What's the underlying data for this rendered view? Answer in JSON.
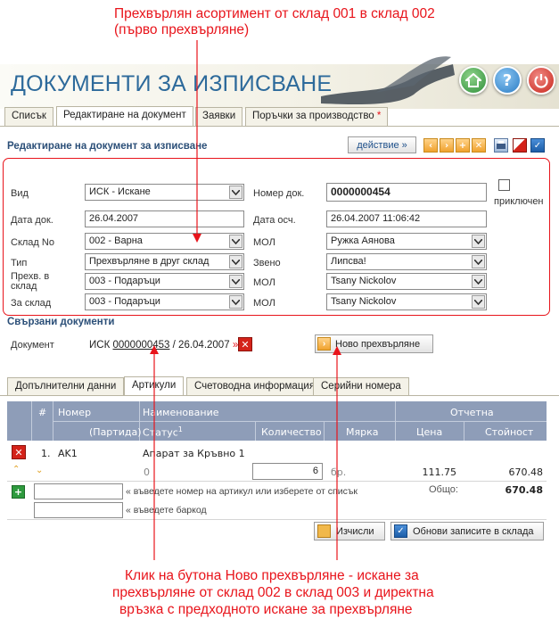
{
  "annotations": {
    "top_line1": "Прехвърлян асортимент от склад 001 в склад 002",
    "top_line2": "(първо прехвърляне)",
    "bottom_line1": "Клик на бутона Ново прехвърляне - искане за",
    "bottom_line2": "прехвърляне от склад 002 в склад 003 и директна",
    "bottom_line3": "връзка с предходното искане за прехвърляне"
  },
  "header": {
    "title": "ДОКУМЕНТИ ЗА ИЗПИСВАНЕ"
  },
  "tabs": [
    {
      "label": "Списък"
    },
    {
      "label": "Редактиране на документ"
    },
    {
      "label": "Заявки"
    },
    {
      "label": "Поръчки за производство",
      "marker": "*"
    }
  ],
  "edit": {
    "title": "Редактиране на документ за изписване",
    "action_label": "действие »"
  },
  "form": {
    "vid_label": "Вид",
    "vid_value": "ИСК - Искане",
    "nomer_label": "Номер док.",
    "nomer_value": "0000000454",
    "prikl_label": "приключен",
    "data_label": "Дата док.",
    "data_value": "26.04.2007",
    "data_osch_label": "Дата осч.",
    "data_osch_value": "26.04.2007 11:06:42",
    "sklad_label": "Склад No",
    "sklad_value": "002 - Варна",
    "mol1_label": "МОЛ",
    "mol1_value": "Ружка Аянова",
    "tip_label": "Тип",
    "tip_value": "Прехвърляне в друг склад",
    "zveno_label": "Звено",
    "zveno_value": "Липсва!",
    "prehv_label_1": "Прехв. в",
    "prehv_label_2": "склад",
    "prehv_value": "003 - Подаръци",
    "mol2_label": "МОЛ",
    "mol2_value": "Tsany Nickolov",
    "za_label": "За склад",
    "za_value": "003 - Подаръци",
    "mol3_label": "МОЛ",
    "mol3_value": "Tsany Nickolov"
  },
  "linked": {
    "title": "Свързани документи",
    "doc_label": "Документ",
    "doc_prefix": "ИСК",
    "doc_number": "0000000453",
    "doc_suffix": "/ 26.04.2007",
    "arrow": "»",
    "new_transfer_label": "Ново прехвърляне"
  },
  "bottom_tabs": [
    {
      "label": "Допълнителни данни"
    },
    {
      "label": "Артикули"
    },
    {
      "label": "Счетоводна информация"
    },
    {
      "label": "Серийни номера"
    }
  ],
  "table": {
    "col_hash": "#",
    "col_nomer": "Номер",
    "col_partida": "(Партида)",
    "col_name": "Наименование",
    "col_status": "Статус",
    "col_status_sup": "1",
    "col_qty": "Количество",
    "col_unit": "Мярка",
    "col_group": "Отчетна",
    "col_price": "Цена",
    "col_value": "Стойност",
    "row": {
      "idx": "1.",
      "nomer": "AK1",
      "name": "Апарат за Кръвно 1",
      "status": "0",
      "qty": "6",
      "unit": "бр.",
      "price": "111.75",
      "value": "670.48"
    },
    "total_label": "Общо:",
    "total_value": "670.48"
  },
  "add": {
    "hint_article": "« въведете номер на артикул или изберете от списък",
    "hint_barcode": "« въведете баркод"
  },
  "footer": {
    "calc_label": "Изчисли",
    "update_label": "Обнови записите в склада"
  },
  "colors": {
    "annotation": "#e8141b",
    "title": "#2d6a9b",
    "table_header": "#8e9db8",
    "highlight_frame": "#e8141b"
  }
}
